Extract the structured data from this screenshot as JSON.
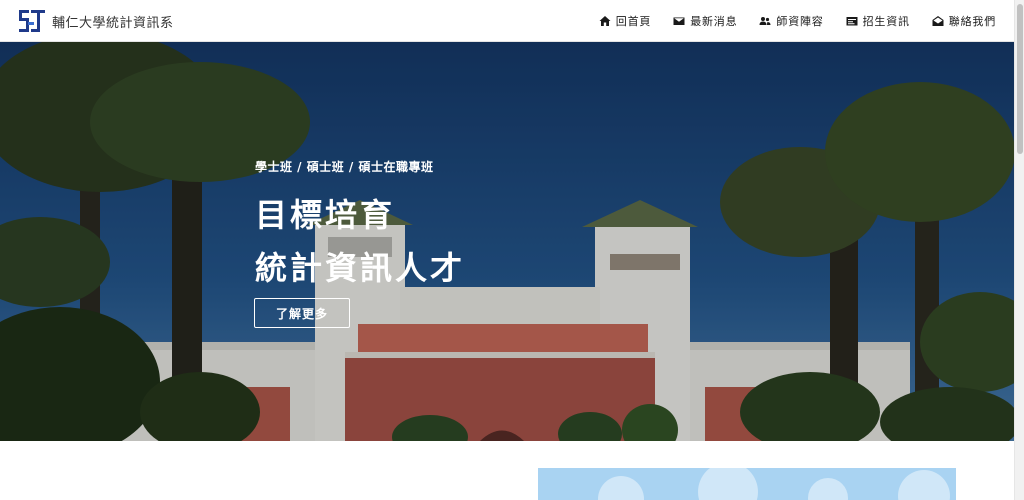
{
  "header": {
    "brand_name": "輔仁大學統計資訊系",
    "nav": [
      {
        "label": "回首頁",
        "icon": "home-icon"
      },
      {
        "label": "最新消息",
        "icon": "envelope-icon"
      },
      {
        "label": "師資陣容",
        "icon": "users-icon"
      },
      {
        "label": "招生資訊",
        "icon": "id-card-icon"
      },
      {
        "label": "聯絡我們",
        "icon": "envelope-open-icon"
      }
    ]
  },
  "hero": {
    "subtitle": "學士班 / 碩士班 / 碩士在職專班",
    "title_line1": "目標培育",
    "title_line2": "統計資訊人才",
    "button_label": "了解更多"
  },
  "colors": {
    "brand": "#1f3a8a",
    "nav_text": "#1a1a1a",
    "hero_text": "#ffffff",
    "accent_strip": "#a9d3f2"
  }
}
